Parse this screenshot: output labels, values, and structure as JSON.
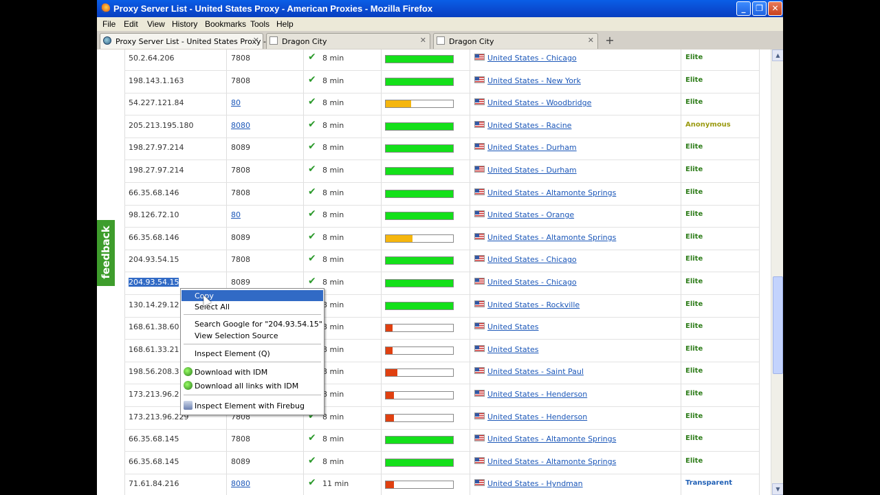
{
  "window": {
    "title": "Proxy Server List - United States Proxy - American Proxies - Mozilla Firefox"
  },
  "menu": [
    "File",
    "Edit",
    "View",
    "History",
    "Bookmarks",
    "Tools",
    "Help"
  ],
  "tabs": [
    {
      "label": "Proxy Server List - United States Proxy - ..."
    },
    {
      "label": "Dragon City"
    },
    {
      "label": "Dragon City"
    }
  ],
  "feedback_label": "feedback",
  "colors": {
    "fast": "#14e01a",
    "medium": "#f5b60e",
    "slow": "#e04010",
    "elite": "#2e7d1a",
    "anonymous": "#9a9a10",
    "transparent": "#1f5fb5"
  },
  "rows": [
    {
      "ip": "50.2.64.206",
      "port": "7808",
      "port_link": false,
      "time": "8 min",
      "speed": 1.0,
      "speed_level": "fast",
      "location": "United States - Chicago",
      "anonymity": "Elite"
    },
    {
      "ip": "198.143.1.163",
      "port": "7808",
      "port_link": false,
      "time": "8 min",
      "speed": 1.0,
      "speed_level": "fast",
      "location": "United States - New York",
      "anonymity": "Elite"
    },
    {
      "ip": "54.227.121.84",
      "port": "80",
      "port_link": true,
      "time": "8 min",
      "speed": 0.38,
      "speed_level": "medium",
      "location": "United States - Woodbridge",
      "anonymity": "Elite"
    },
    {
      "ip": "205.213.195.180",
      "port": "8080",
      "port_link": true,
      "time": "8 min",
      "speed": 1.0,
      "speed_level": "fast",
      "location": "United States - Racine",
      "anonymity": "Anonymous"
    },
    {
      "ip": "198.27.97.214",
      "port": "8089",
      "port_link": false,
      "time": "8 min",
      "speed": 1.0,
      "speed_level": "fast",
      "location": "United States - Durham",
      "anonymity": "Elite"
    },
    {
      "ip": "198.27.97.214",
      "port": "7808",
      "port_link": false,
      "time": "8 min",
      "speed": 1.0,
      "speed_level": "fast",
      "location": "United States - Durham",
      "anonymity": "Elite"
    },
    {
      "ip": "66.35.68.146",
      "port": "7808",
      "port_link": false,
      "time": "8 min",
      "speed": 1.0,
      "speed_level": "fast",
      "location": "United States - Altamonte Springs",
      "anonymity": "Elite"
    },
    {
      "ip": "98.126.72.10",
      "port": "80",
      "port_link": true,
      "time": "8 min",
      "speed": 1.0,
      "speed_level": "fast",
      "location": "United States - Orange",
      "anonymity": "Elite"
    },
    {
      "ip": "66.35.68.146",
      "port": "8089",
      "port_link": false,
      "time": "8 min",
      "speed": 0.4,
      "speed_level": "medium",
      "location": "United States - Altamonte Springs",
      "anonymity": "Elite"
    },
    {
      "ip": "204.93.54.15",
      "port": "7808",
      "port_link": false,
      "time": "8 min",
      "speed": 1.0,
      "speed_level": "fast",
      "location": "United States - Chicago",
      "anonymity": "Elite"
    },
    {
      "ip": "204.93.54.15",
      "port": "8089",
      "port_link": false,
      "time": "8 min",
      "speed": 1.0,
      "speed_level": "fast",
      "location": "United States - Chicago",
      "anonymity": "Elite",
      "selected": true
    },
    {
      "ip": "130.14.29.12",
      "port": "",
      "port_link": false,
      "time": "8 min",
      "speed": 1.0,
      "speed_level": "fast",
      "location": "United States - Rockville",
      "anonymity": "Elite"
    },
    {
      "ip": "168.61.38.60",
      "port": "",
      "port_link": false,
      "time": "8 min",
      "speed": 0.1,
      "speed_level": "slow",
      "location": "United States",
      "anonymity": "Elite"
    },
    {
      "ip": "168.61.33.21",
      "port": "",
      "port_link": false,
      "time": "8 min",
      "speed": 0.1,
      "speed_level": "slow",
      "location": "United States",
      "anonymity": "Elite"
    },
    {
      "ip": "198.56.208.3",
      "port": "",
      "port_link": false,
      "time": "8 min",
      "speed": 0.17,
      "speed_level": "slow",
      "location": "United States - Saint Paul",
      "anonymity": "Elite"
    },
    {
      "ip": "173.213.96.2",
      "port": "",
      "port_link": false,
      "time": "8 min",
      "speed": 0.12,
      "speed_level": "slow",
      "location": "United States - Henderson",
      "anonymity": "Elite"
    },
    {
      "ip": "173.213.96.229",
      "port": "7808",
      "port_link": false,
      "time": "8 min",
      "speed": 0.12,
      "speed_level": "slow",
      "location": "United States - Henderson",
      "anonymity": "Elite"
    },
    {
      "ip": "66.35.68.145",
      "port": "7808",
      "port_link": false,
      "time": "8 min",
      "speed": 1.0,
      "speed_level": "fast",
      "location": "United States - Altamonte Springs",
      "anonymity": "Elite"
    },
    {
      "ip": "66.35.68.145",
      "port": "8089",
      "port_link": false,
      "time": "8 min",
      "speed": 1.0,
      "speed_level": "fast",
      "location": "United States - Altamonte Springs",
      "anonymity": "Elite"
    },
    {
      "ip": "71.61.84.216",
      "port": "8080",
      "port_link": true,
      "time": "11 min",
      "speed": 0.12,
      "speed_level": "slow",
      "location": "United States - Hyndman",
      "anonymity": "Transparent"
    }
  ],
  "context_menu": {
    "items": [
      {
        "label": "Copy",
        "highlight": true,
        "icon": ""
      },
      {
        "label": "Select All",
        "icon": ""
      },
      {
        "label": "Search Google for \"204.93.54.15\"",
        "icon": ""
      },
      {
        "label": "View Selection Source",
        "icon": ""
      },
      {
        "label": "Inspect Element (Q)",
        "icon": ""
      },
      {
        "label": "Download with IDM",
        "icon": "idm-icon"
      },
      {
        "label": "Download all links with IDM",
        "icon": "idm-icon"
      },
      {
        "label": "Inspect Element with Firebug",
        "icon": "firebug-icon"
      }
    ]
  }
}
